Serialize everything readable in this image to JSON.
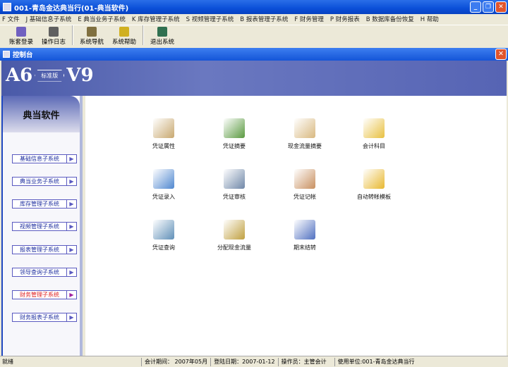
{
  "window": {
    "title": "001-青岛金达典当行(01-典当软件)"
  },
  "menu": [
    "F 文件",
    "J 基础信息子系统",
    "E 典当业务子系统",
    "K 库存管理子系统",
    "S 视频管理子系统",
    "B 报表管理子系统",
    "F 财务管理",
    "P 财务报表",
    "B 数据库备份恢复",
    "H 帮助"
  ],
  "toolbar": [
    {
      "label": "账套登录",
      "icon": "login-icon",
      "color": "#7060c0"
    },
    {
      "label": "操作日志",
      "icon": "log-icon",
      "color": "#606060"
    },
    {
      "label": "系统导航",
      "icon": "navigation-icon",
      "color": "#807040"
    },
    {
      "label": "系统帮助",
      "icon": "help-icon",
      "color": "#d0b020"
    },
    {
      "label": "退出系统",
      "icon": "exit-icon",
      "color": "#307050"
    }
  ],
  "panel": {
    "title": "控制台"
  },
  "banner": {
    "logo_left": "A6",
    "logo_mid": "标准版",
    "logo_right": "V9"
  },
  "sidebar": {
    "title": "典当软件",
    "items": [
      "基础信息子系统",
      "典当业务子系统",
      "库存管理子系统",
      "视频管理子系统",
      "报表管理子系统",
      "领导查询子系统",
      "财务管理子系统",
      "财务报表子系统"
    ],
    "active": "财务管理子系统"
  },
  "functions": [
    {
      "label": "凭证属性",
      "icon": "voucher-property-icon",
      "color": "#c8a870"
    },
    {
      "label": "凭证摘要",
      "icon": "voucher-summary-icon",
      "color": "#5a9a40"
    },
    {
      "label": "现金流量摘要",
      "icon": "cashflow-summary-icon",
      "color": "#d8b880"
    },
    {
      "label": "会计科目",
      "icon": "accounting-subject-icon",
      "color": "#e8c040"
    },
    {
      "label": "凭证录入",
      "icon": "voucher-entry-icon",
      "color": "#5088d0"
    },
    {
      "label": "凭证审核",
      "icon": "voucher-audit-icon",
      "color": "#7088a8"
    },
    {
      "label": "凭证记帐",
      "icon": "voucher-posting-icon",
      "color": "#c89060"
    },
    {
      "label": "自动转帐模板",
      "icon": "auto-transfer-template-icon",
      "color": "#e8b830"
    },
    {
      "label": "凭证查询",
      "icon": "voucher-query-icon",
      "color": "#6090b8"
    },
    {
      "label": "分配现金流量",
      "icon": "allocate-cashflow-icon",
      "color": "#c0a040"
    },
    {
      "label": "期末结转",
      "icon": "period-end-carryover-icon",
      "color": "#5070c0"
    }
  ],
  "status": {
    "ready": "就绪",
    "period": "会计期间： 2007年05月",
    "login_date": "登陆日期：2007-01-12",
    "operator": "操作员：主管会计",
    "unit": "使用单位:001-青岛金达典当行"
  }
}
